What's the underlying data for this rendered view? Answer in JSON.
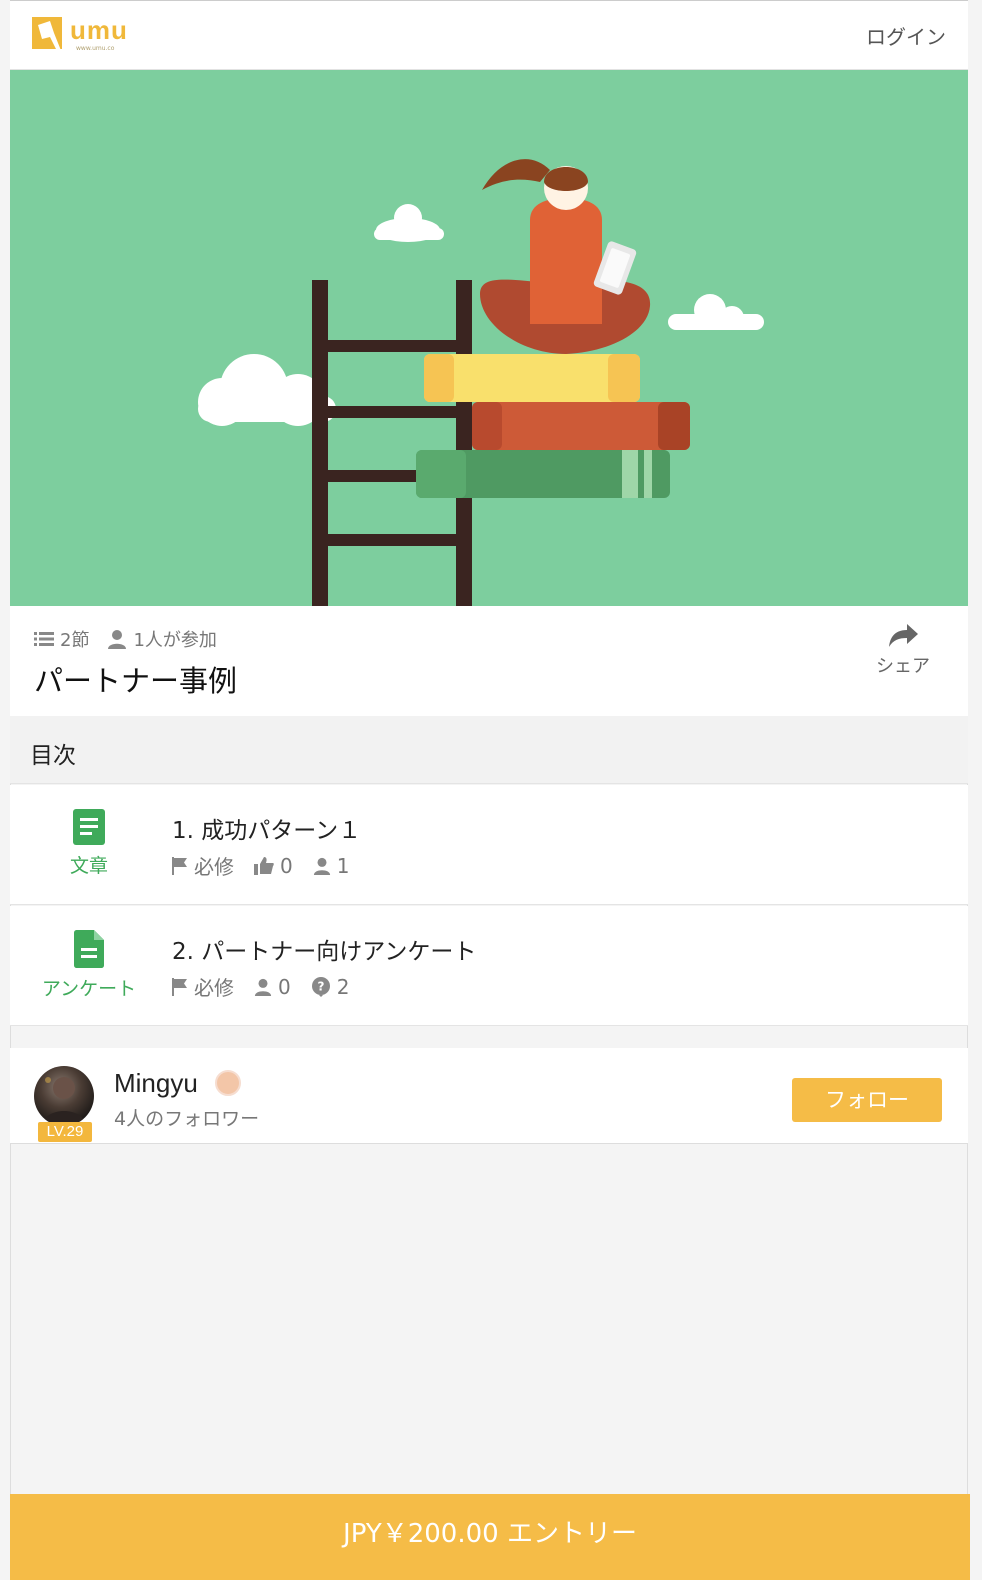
{
  "header": {
    "logo_text": "umu",
    "logo_sub": "www.umu.co",
    "login_label": "ログイン"
  },
  "course": {
    "sections": "2節",
    "participants": "1人が参加",
    "title": "パートナー事例",
    "share_label": "シェア"
  },
  "toc": {
    "heading": "目次",
    "items": [
      {
        "type_label": "文章",
        "name": "1. 成功パターン１",
        "required": "必修",
        "stat1": "0",
        "stat2": "1"
      },
      {
        "type_label": "アンケート",
        "name": "2. パートナー向けアンケート",
        "required": "必修",
        "stat1": "0",
        "stat2": "2"
      }
    ]
  },
  "author": {
    "name": "Mingyu",
    "level": "LV.29",
    "followers": "4人のフォロワー",
    "follow_label": "フォロー"
  },
  "bottom": {
    "cta": "JPY￥200.00  エントリー"
  },
  "colors": {
    "accent": "#f5bc47",
    "green": "#3faa5a",
    "hero_bg": "#7dce9e"
  }
}
